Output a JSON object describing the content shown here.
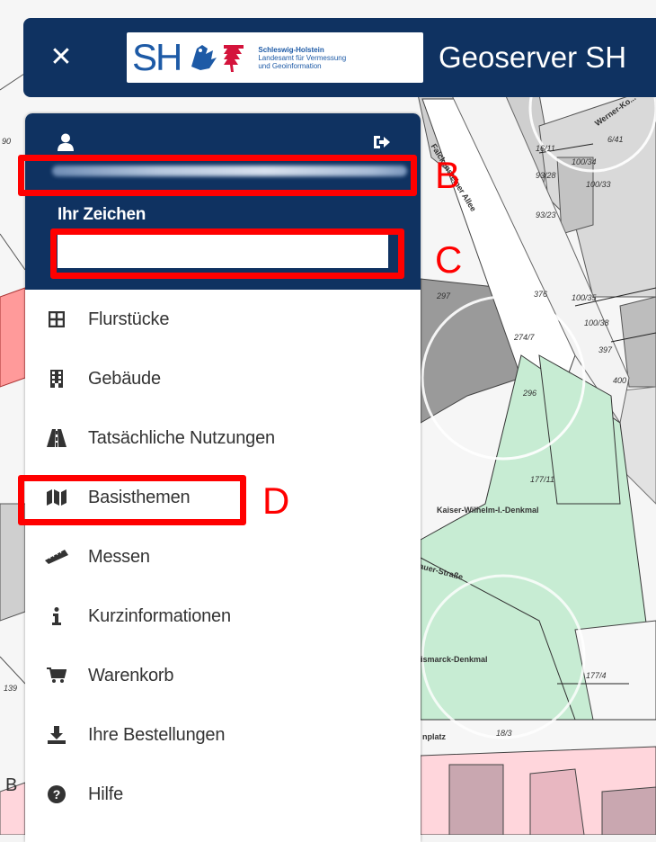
{
  "header": {
    "title": "Geoserver SH",
    "logo": {
      "abbr": "SH",
      "line1": "Schleswig-Holstein",
      "line2": "Landesamt für Vermessung",
      "line3": "und Geoinformation"
    }
  },
  "colors": {
    "header_bg": "#0f3261",
    "annotation": "#ff0000",
    "map_green": "#c7ecd3",
    "map_grey": "#cfcfcf",
    "map_pink": "#ffd6dc",
    "map_red": "#ff9a9a"
  },
  "user": {
    "zeichen_label": "Ihr Zeichen",
    "zeichen_value": ""
  },
  "menu": [
    {
      "icon": "grid-icon",
      "label": "Flurstücke"
    },
    {
      "icon": "building-icon",
      "label": "Gebäude"
    },
    {
      "icon": "road-icon",
      "label": "Tatsächliche Nutzungen"
    },
    {
      "icon": "map-icon",
      "label": "Basisthemen"
    },
    {
      "icon": "ruler-icon",
      "label": "Messen"
    },
    {
      "icon": "info-icon",
      "label": "Kurzinformationen"
    },
    {
      "icon": "cart-icon",
      "label": "Warenkorb"
    },
    {
      "icon": "download-icon",
      "label": "Ihre Bestellungen"
    },
    {
      "icon": "question-icon",
      "label": "Hilfe"
    }
  ],
  "annotations": {
    "b": "B",
    "c": "C",
    "d": "D"
  },
  "map_labels": {
    "parcel_16_11": "16/11",
    "parcel_6_41": "6/41",
    "parcel_100_34": "100/34",
    "parcel_93_28": "93/28",
    "parcel_100_33": "100/33",
    "parcel_93_23": "93/23",
    "parcel_376": "376",
    "parcel_100_35": "100/35",
    "parcel_297": "297",
    "parcel_274_7": "274/7",
    "parcel_100_38": "100/38",
    "parcel_397": "397",
    "parcel_400": "400",
    "parcel_296": "296",
    "parcel_177_11": "177/11",
    "parcel_177_4": "177/4",
    "parcel_18_3": "18/3",
    "street_falckensteiner": "Falckensteiner Allee",
    "street_werner": "Werner-Ko...",
    "denkmal_kaiser": "Kaiser-Wilhelm-I.-Denkmal",
    "denkmal_bismarck": "ismarck-Denkmal",
    "street_bauer": "auer-Straße",
    "platz": "nplatz",
    "left_1": "90",
    "left_2": "139",
    "left_b": "B"
  }
}
